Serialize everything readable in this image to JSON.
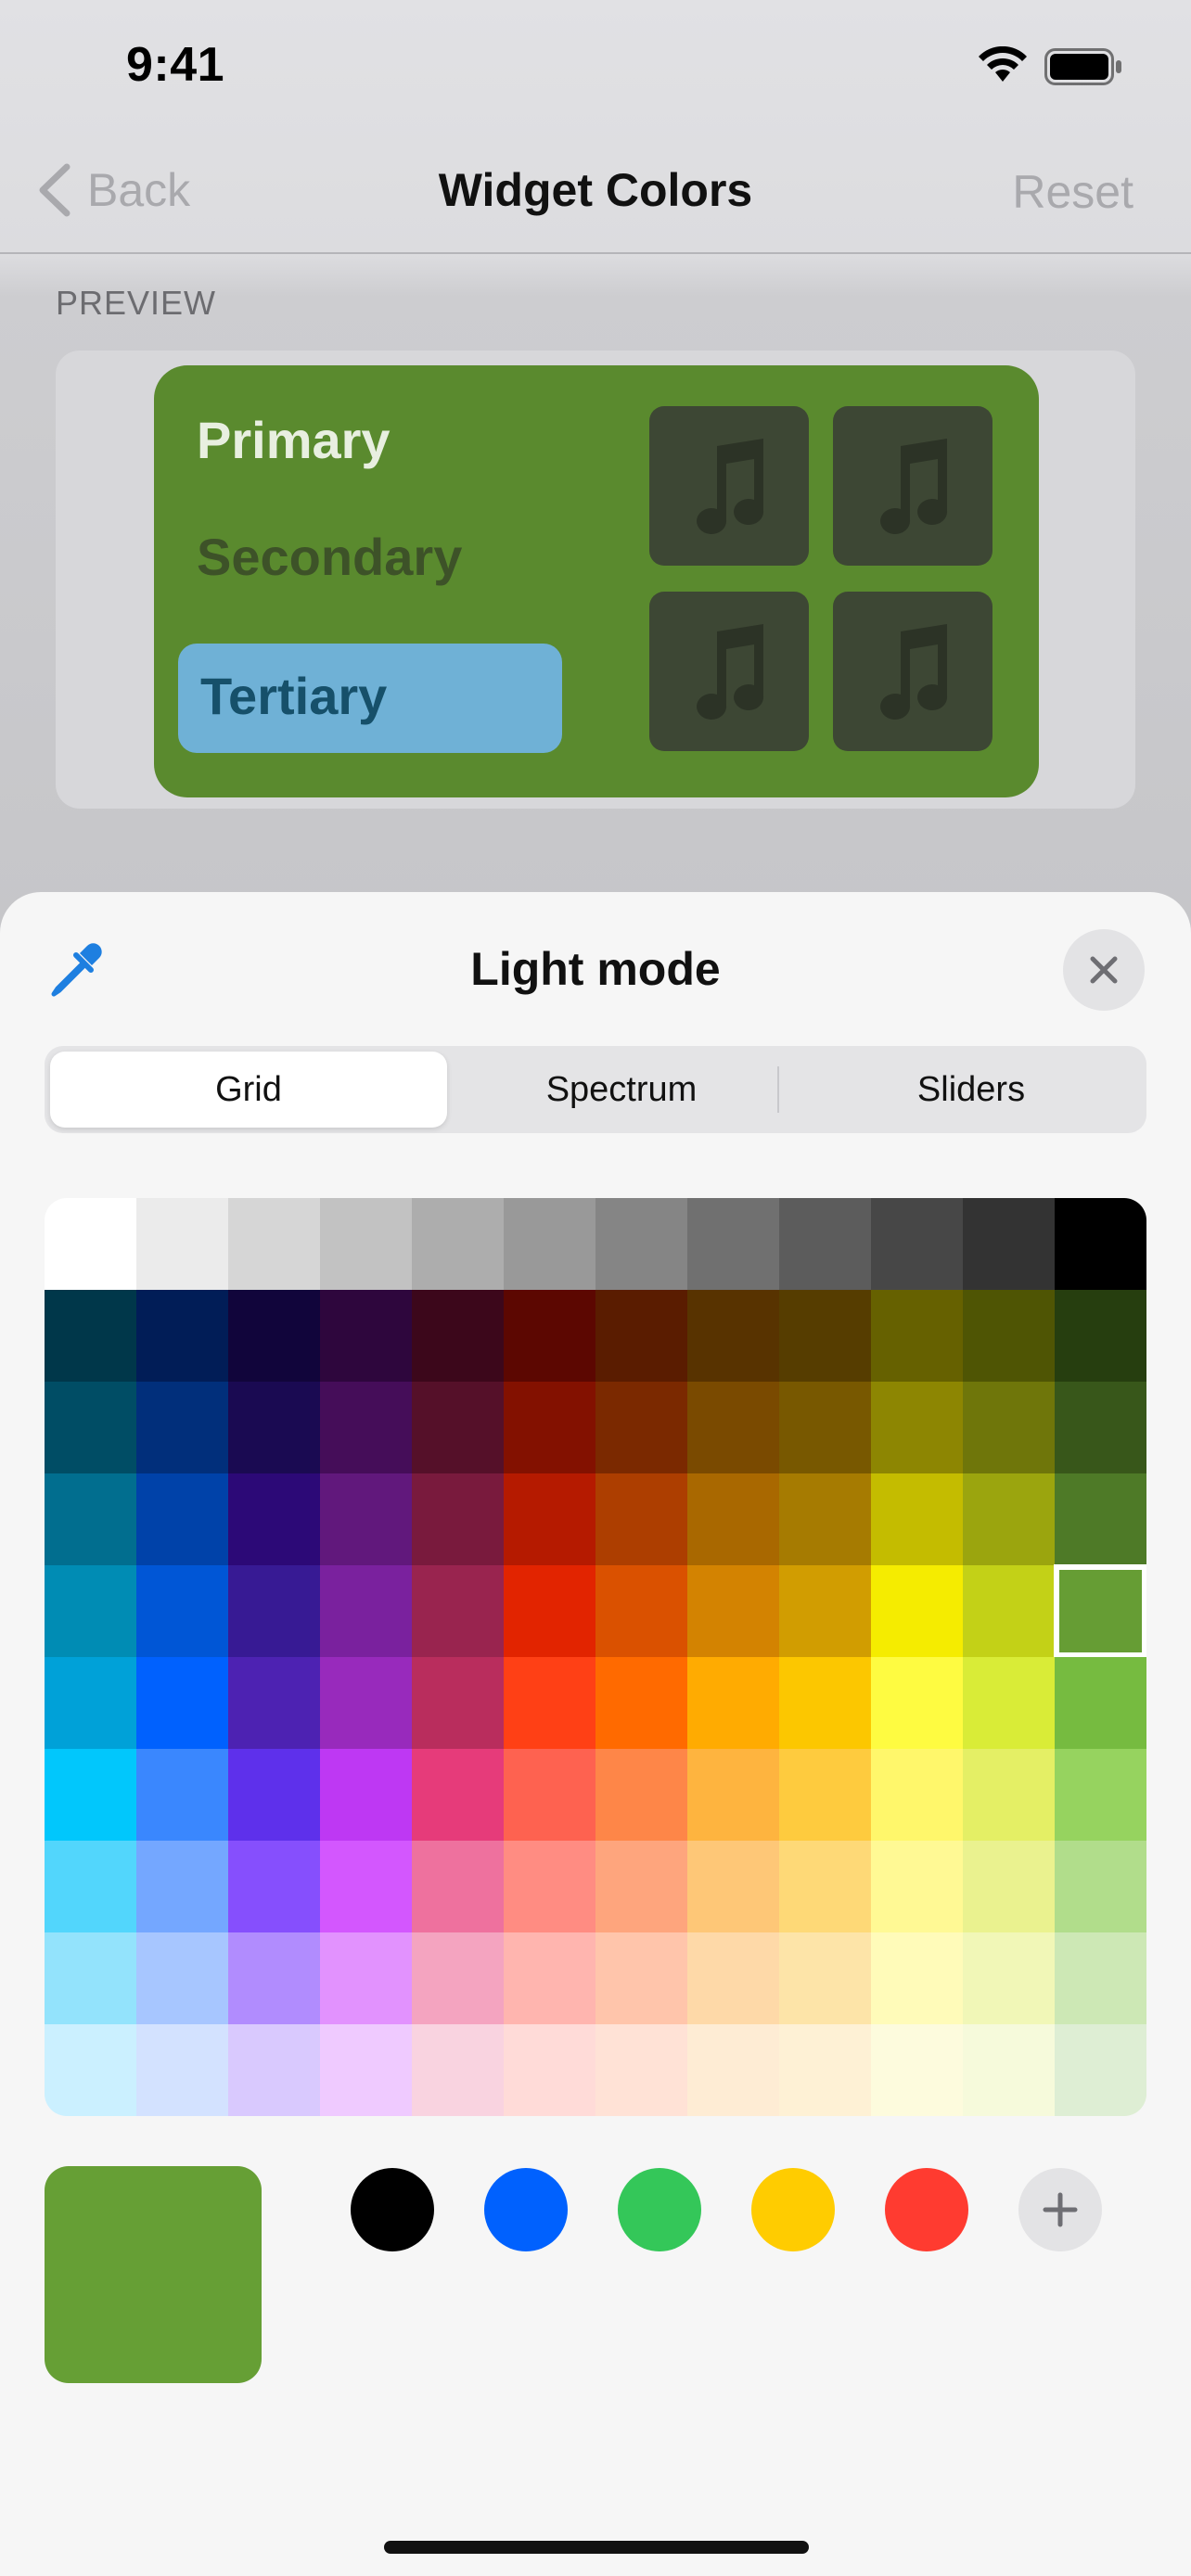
{
  "status_bar": {
    "time": "9:41"
  },
  "nav": {
    "back_label": "Back",
    "title": "Widget Colors",
    "reset_label": "Reset"
  },
  "preview": {
    "section_label": "PREVIEW",
    "primary_label": "Primary",
    "secondary_label": "Secondary",
    "tertiary_label": "Tertiary",
    "widget_color": "#5a8a2e",
    "tiles_icon": "music-note-icon"
  },
  "sheet": {
    "title": "Light mode",
    "tabs": [
      {
        "label": "Grid",
        "selected": true
      },
      {
        "label": "Spectrum",
        "selected": false
      },
      {
        "label": "Sliders",
        "selected": false
      }
    ]
  },
  "color_grid": {
    "selected": {
      "row": 4,
      "col": 11
    },
    "rows": [
      [
        "#ffffff",
        "#ebebeb",
        "#d6d6d6",
        "#c2c2c2",
        "#adadad",
        "#999999",
        "#858585",
        "#707070",
        "#5c5c5c",
        "#474747",
        "#333333",
        "#000000"
      ],
      [
        "#00374a",
        "#011d57",
        "#11053b",
        "#2e063d",
        "#3c071b",
        "#5c0701",
        "#5a1c00",
        "#583300",
        "#563d00",
        "#666100",
        "#4f5504",
        "#263e0f"
      ],
      [
        "#004d65",
        "#012f7b",
        "#1a0a52",
        "#450d59",
        "#551029",
        "#831100",
        "#7b2900",
        "#7a4a00",
        "#785800",
        "#8d8602",
        "#6f760a",
        "#38571a"
      ],
      [
        "#016e8f",
        "#0042a9",
        "#2c0977",
        "#61187c",
        "#791a3d",
        "#b51a00",
        "#ad3e00",
        "#a96800",
        "#a67b01",
        "#c4bc00",
        "#9ba50e",
        "#4e7a27"
      ],
      [
        "#008cb4",
        "#0056d6",
        "#371a94",
        "#7a219e",
        "#99244f",
        "#e22400",
        "#da5100",
        "#d38301",
        "#d19d01",
        "#f5ec00",
        "#c3d117",
        "#669d34"
      ],
      [
        "#00a1d8",
        "#0061fe",
        "#4d22b2",
        "#982abc",
        "#b92d5d",
        "#ff4015",
        "#ff6a00",
        "#ffab01",
        "#fcc700",
        "#fefb41",
        "#d9ec37",
        "#76bb40"
      ],
      [
        "#01c7fc",
        "#3a87fe",
        "#5e30eb",
        "#be38f3",
        "#e63b7a",
        "#fe6250",
        "#fe8648",
        "#feb43f",
        "#fecb3e",
        "#fff76b",
        "#e4ef65",
        "#96d35f"
      ],
      [
        "#52d6fc",
        "#74a7ff",
        "#864ffd",
        "#d357fe",
        "#ee719e",
        "#ff8c82",
        "#fea57d",
        "#fec777",
        "#fed977",
        "#fff994",
        "#eaf28f",
        "#b1dd8b"
      ],
      [
        "#93e3fc",
        "#a7c6ff",
        "#b18cfe",
        "#e292fe",
        "#f4a4c0",
        "#ffb5af",
        "#ffc5ab",
        "#fed9a8",
        "#fde4a8",
        "#fffbb9",
        "#f1f7b7",
        "#cde8b5"
      ],
      [
        "#cbf0ff",
        "#d3e2ff",
        "#d9c9fe",
        "#efcaff",
        "#f9d3e0",
        "#ffdbd8",
        "#ffe2d6",
        "#feecd4",
        "#fef1d5",
        "#fdfbdd",
        "#f6fadb",
        "#deeed4"
      ]
    ]
  },
  "current_color": "#669f35",
  "presets": [
    {
      "name": "black",
      "color": "#000000"
    },
    {
      "name": "blue",
      "color": "#0061fe"
    },
    {
      "name": "green",
      "color": "#34c759"
    },
    {
      "name": "yellow",
      "color": "#ffcc00"
    },
    {
      "name": "red",
      "color": "#ff3b30"
    }
  ]
}
